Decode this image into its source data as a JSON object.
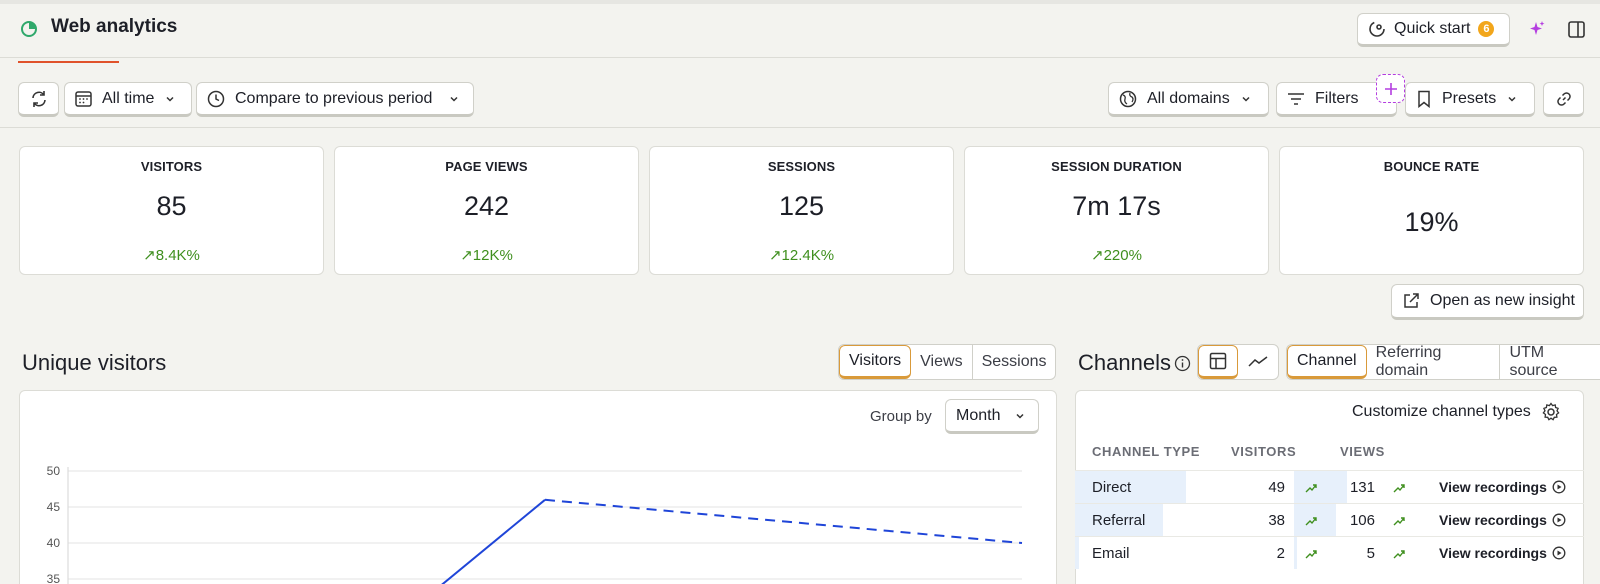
{
  "header": {
    "title": "Web analytics",
    "quick_start_label": "Quick start",
    "quick_start_badge": "6"
  },
  "toolbar": {
    "date_range": "All time",
    "compare": "Compare to previous period",
    "domains": "All domains",
    "filters": "Filters",
    "presets": "Presets"
  },
  "stats": [
    {
      "title": "VISITORS",
      "value": "85",
      "delta": "8.4K%"
    },
    {
      "title": "PAGE VIEWS",
      "value": "242",
      "delta": "12K%"
    },
    {
      "title": "SESSIONS",
      "value": "125",
      "delta": "12.4K%"
    },
    {
      "title": "SESSION DURATION",
      "value": "7m 17s",
      "delta": "220%"
    },
    {
      "title": "BOUNCE RATE",
      "value": "19%",
      "delta": ""
    }
  ],
  "open_insight_label": "Open as new insight",
  "unique_visitors": {
    "title": "Unique visitors",
    "tabs": [
      "Visitors",
      "Views",
      "Sessions"
    ],
    "active_tab": "Visitors",
    "group_by_label": "Group by",
    "group_by_value": "Month"
  },
  "chart_data": {
    "type": "line",
    "title": "",
    "xlabel": "",
    "ylabel": "",
    "ylim": [
      35,
      50
    ],
    "y_ticks": [
      50,
      45,
      40,
      35
    ],
    "grid": true,
    "series": [
      {
        "style": "solid",
        "color": "#1f45d8",
        "points": [
          {
            "x": 0.78,
            "y": 34
          },
          {
            "x": 1,
            "y": 46
          }
        ]
      },
      {
        "style": "dashed",
        "color": "#1f45d8",
        "points": [
          {
            "x": 1,
            "y": 46
          },
          {
            "x": 2,
            "y": 40
          }
        ]
      }
    ]
  },
  "channels": {
    "title": "Channels",
    "tabs": [
      "Channel",
      "Referring domain",
      "UTM source"
    ],
    "active_tab": "Channel",
    "customize_label": "Customize channel types",
    "columns": [
      "CHANNEL TYPE",
      "VISITORS",
      "VIEWS"
    ],
    "rows": [
      {
        "type": "Direct",
        "visitors": "49",
        "views": "131",
        "action": "View recordings",
        "visitors_share": 0.53,
        "views_share": 0.53
      },
      {
        "type": "Referral",
        "visitors": "38",
        "views": "106",
        "action": "View recordings",
        "visitors_share": 0.42,
        "views_share": 0.42
      },
      {
        "type": "Email",
        "visitors": "2",
        "views": "5",
        "action": "View recordings",
        "visitors_share": 0.02,
        "views_share": 0.02
      }
    ]
  },
  "colors": {
    "accent": "#e0522b",
    "active_tab": "#d99a3a",
    "positive": "#3f8f1e",
    "line": "#1f45d8",
    "row_highlight": "#e7f0fb",
    "badge": "#f2a61b",
    "ai": "#b43ee0"
  }
}
